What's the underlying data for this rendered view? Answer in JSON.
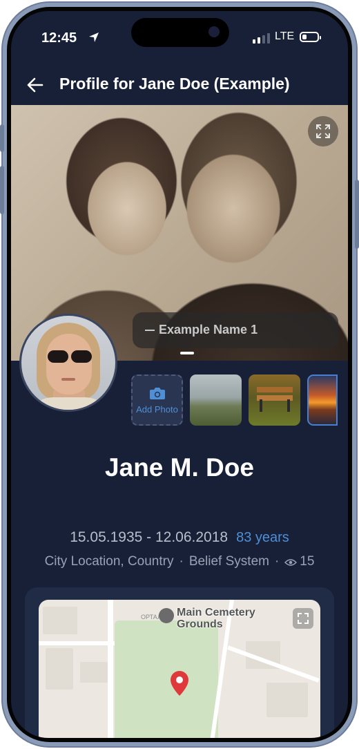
{
  "status_bar": {
    "time": "12:45",
    "network": "LTE",
    "battery_level": 0.3
  },
  "header": {
    "title": "Profile for Jane Doe (Example)",
    "back_icon": "arrow-left-icon"
  },
  "hero": {
    "caption": "Example Name 1",
    "expand_icon": "expand-icon"
  },
  "gallery": {
    "add_photo_label": "Add Photo",
    "add_icon": "camera-icon"
  },
  "profile": {
    "name": "Jane M. Doe",
    "dates": "15.05.1935 - 12.06.2018",
    "age": "83 years",
    "location": "City Location, Country",
    "belief": "Belief System",
    "views": "15"
  },
  "map": {
    "place_name": "Main Cemetery Grounds",
    "small_label_top": "ОРТАЛ",
    "colors": {
      "accent": "#4f8fd6",
      "pin": "#e0393b",
      "background": "#172037"
    }
  }
}
